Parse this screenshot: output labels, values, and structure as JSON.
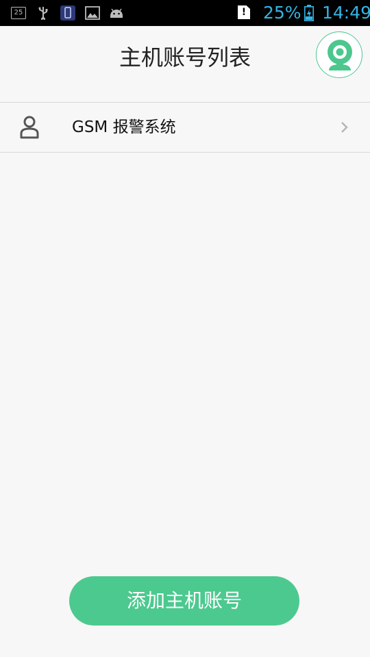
{
  "status_bar": {
    "calendar_day": "25",
    "battery_percent": "25%",
    "time": "14:49",
    "sim_alert": "!",
    "icons": [
      "calendar-icon",
      "usb-icon",
      "phone-icon",
      "image-icon",
      "android-icon",
      "sim-alert-icon",
      "battery-charging-icon"
    ]
  },
  "header": {
    "title": "主机账号列表",
    "avatar_icon": "webcam-icon"
  },
  "accounts": [
    {
      "label": "GSM 报警系统",
      "icon": "user-icon",
      "action_icon": "chevron-right-icon"
    }
  ],
  "footer": {
    "add_button_label": "添加主机账号"
  },
  "colors": {
    "accent": "#4cc98f",
    "status_text": "#33b5e5",
    "background": "#f7f7f7"
  }
}
